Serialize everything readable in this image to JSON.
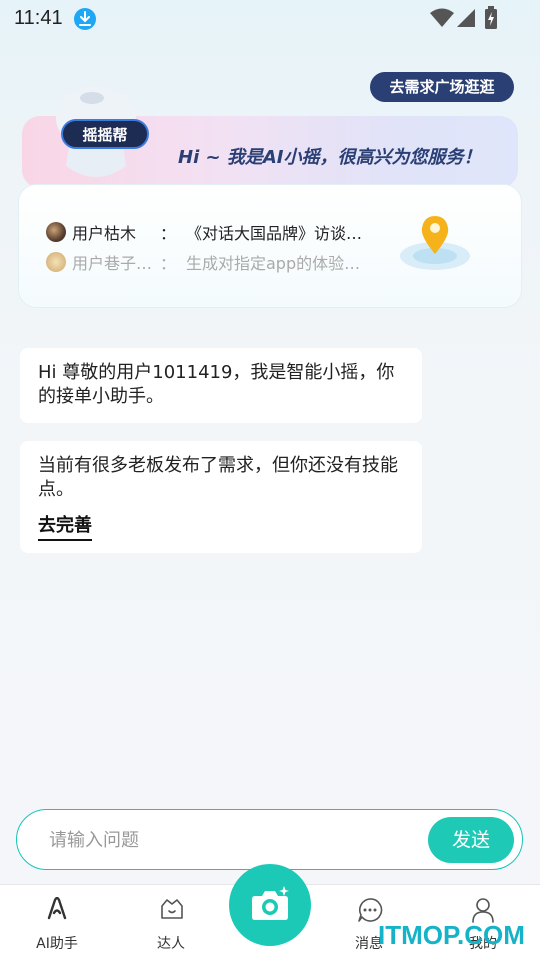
{
  "status_bar": {
    "time": "11:41"
  },
  "header": {
    "plaza_button": "去需求广场逛逛"
  },
  "banner": {
    "mascot_badge": "摇摇帮",
    "greeting": "Hi ~ 我是AI小摇，很高兴为您服务！"
  },
  "feed": [
    {
      "user": "用户枯木",
      "colon": "：",
      "text": "《对话大国品牌》访谈…"
    },
    {
      "user": "用户巷子…",
      "colon": "：",
      "text": "生成对指定app的体验…"
    }
  ],
  "chat": {
    "msg1": "Hi 尊敬的用户1011419，我是智能小摇，你的接单小助手。",
    "msg2": "当前有很多老板发布了需求，但你还没有技能点。",
    "improve_link": "去完善"
  },
  "input": {
    "placeholder": "请输入问题",
    "send_label": "发送"
  },
  "tabs": [
    {
      "label": "AI助手",
      "icon": "ai-assistant-icon"
    },
    {
      "label": "达人",
      "icon": "talent-icon"
    },
    {
      "label": "消息",
      "icon": "message-icon"
    },
    {
      "label": "我的",
      "icon": "profile-icon"
    }
  ],
  "watermark": "ITMOP.COM",
  "colors": {
    "accent": "#1ec9b6",
    "navy": "#2a3f74",
    "download_badge": "#1ea7f5"
  }
}
